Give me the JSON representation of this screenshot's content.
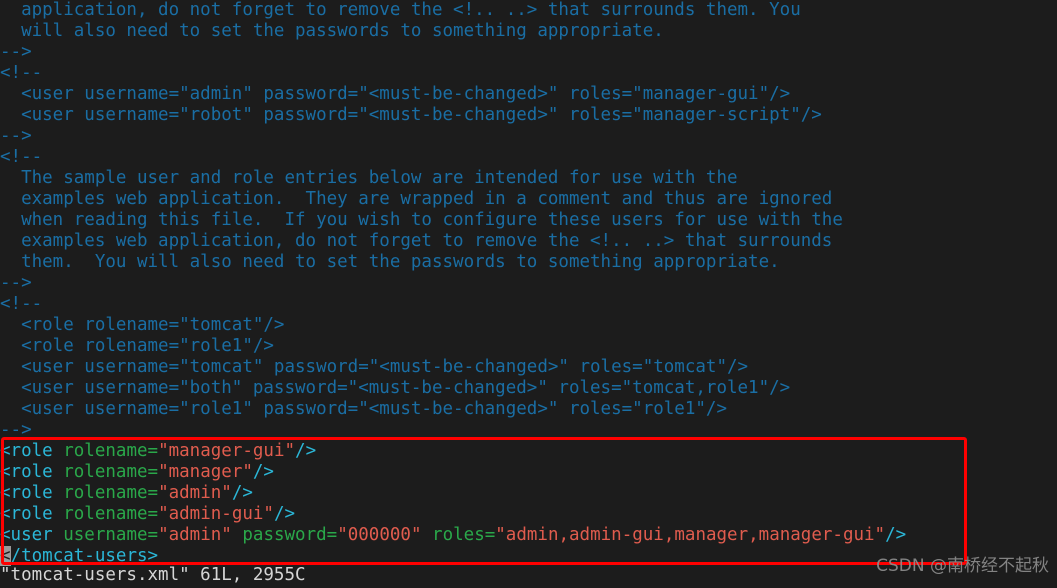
{
  "terminal": {
    "background_color": "#1c1c1c",
    "comment_color": "#1a6ea4",
    "tag_color": "#2bb7d8",
    "attr_color": "#2aa84a",
    "value_color": "#e05c4e",
    "status_text_color": "#d6d6d6",
    "highlight_box_color": "#fe0000",
    "cursor_color": "#9a9a9a"
  },
  "editor": {
    "lines": [
      {
        "kind": "comment",
        "text": "  application, do not forget to remove the <!.. ..> that surrounds them. You"
      },
      {
        "kind": "comment",
        "text": "  will also need to set the passwords to something appropriate."
      },
      {
        "kind": "comment",
        "text": "-->"
      },
      {
        "kind": "comment",
        "text": "<!--"
      },
      {
        "kind": "comment",
        "text": "  <user username=\"admin\" password=\"<must-be-changed>\" roles=\"manager-gui\"/>"
      },
      {
        "kind": "comment",
        "text": "  <user username=\"robot\" password=\"<must-be-changed>\" roles=\"manager-script\"/>"
      },
      {
        "kind": "comment",
        "text": "-->"
      },
      {
        "kind": "comment",
        "text": "<!--"
      },
      {
        "kind": "comment",
        "text": "  The sample user and role entries below are intended for use with the"
      },
      {
        "kind": "comment",
        "text": "  examples web application.  They are wrapped in a comment and thus are ignored"
      },
      {
        "kind": "comment",
        "text": "  when reading this file.  If you wish to configure these users for use with the"
      },
      {
        "kind": "comment",
        "text": "  examples web application, do not forget to remove the <!.. ..> that surrounds"
      },
      {
        "kind": "comment",
        "text": "  them.  You will also need to set the passwords to something appropriate."
      },
      {
        "kind": "comment",
        "text": "-->"
      },
      {
        "kind": "comment",
        "text": "<!--"
      },
      {
        "kind": "comment",
        "text": "  <role rolename=\"tomcat\"/>"
      },
      {
        "kind": "comment",
        "text": "  <role rolename=\"role1\"/>"
      },
      {
        "kind": "comment",
        "text": "  <user username=\"tomcat\" password=\"<must-be-changed>\" roles=\"tomcat\"/>"
      },
      {
        "kind": "comment",
        "text": "  <user username=\"both\" password=\"<must-be-changed>\" roles=\"tomcat,role1\"/>"
      },
      {
        "kind": "comment",
        "text": "  <user username=\"role1\" password=\"<must-be-changed>\" roles=\"role1\"/>"
      },
      {
        "kind": "comment",
        "text": "-->"
      },
      {
        "kind": "xml",
        "tokens": [
          {
            "t": "tag",
            "s": "<role"
          },
          {
            "t": "plain",
            "s": " "
          },
          {
            "t": "attr",
            "s": "rolename="
          },
          {
            "t": "val",
            "s": "\"manager-gui\""
          },
          {
            "t": "punct",
            "s": "/>"
          }
        ]
      },
      {
        "kind": "xml",
        "tokens": [
          {
            "t": "tag",
            "s": "<role"
          },
          {
            "t": "plain",
            "s": " "
          },
          {
            "t": "attr",
            "s": "rolename="
          },
          {
            "t": "val",
            "s": "\"manager\""
          },
          {
            "t": "punct",
            "s": "/>"
          }
        ]
      },
      {
        "kind": "xml",
        "tokens": [
          {
            "t": "tag",
            "s": "<role"
          },
          {
            "t": "plain",
            "s": " "
          },
          {
            "t": "attr",
            "s": "rolename="
          },
          {
            "t": "val",
            "s": "\"admin\""
          },
          {
            "t": "punct",
            "s": "/>"
          }
        ]
      },
      {
        "kind": "xml",
        "tokens": [
          {
            "t": "tag",
            "s": "<role"
          },
          {
            "t": "plain",
            "s": " "
          },
          {
            "t": "attr",
            "s": "rolename="
          },
          {
            "t": "val",
            "s": "\"admin-gui\""
          },
          {
            "t": "punct",
            "s": "/>"
          }
        ]
      },
      {
        "kind": "xml",
        "tokens": [
          {
            "t": "tag",
            "s": "<user"
          },
          {
            "t": "plain",
            "s": " "
          },
          {
            "t": "attr",
            "s": "username="
          },
          {
            "t": "val",
            "s": "\"admin\""
          },
          {
            "t": "plain",
            "s": " "
          },
          {
            "t": "attr",
            "s": "password="
          },
          {
            "t": "val",
            "s": "\"000000\""
          },
          {
            "t": "plain",
            "s": " "
          },
          {
            "t": "attr",
            "s": "roles="
          },
          {
            "t": "val",
            "s": "\"admin,admin-gui,manager,manager-gui\""
          },
          {
            "t": "punct",
            "s": "/>"
          }
        ]
      },
      {
        "kind": "xml",
        "tokens": [
          {
            "t": "cursor",
            "s": "<"
          },
          {
            "t": "tag",
            "s": "/tomcat-users>"
          }
        ]
      }
    ]
  },
  "highlight_box": {
    "label": "annotation-rectangle",
    "color": "#fe0000"
  },
  "status": {
    "text": "\"tomcat-users.xml\" 61L, 2955C",
    "filename": "tomcat-users.xml",
    "lines": "61L",
    "chars": "2955C"
  },
  "watermark": {
    "text": "CSDN @南桥经不起秋"
  }
}
